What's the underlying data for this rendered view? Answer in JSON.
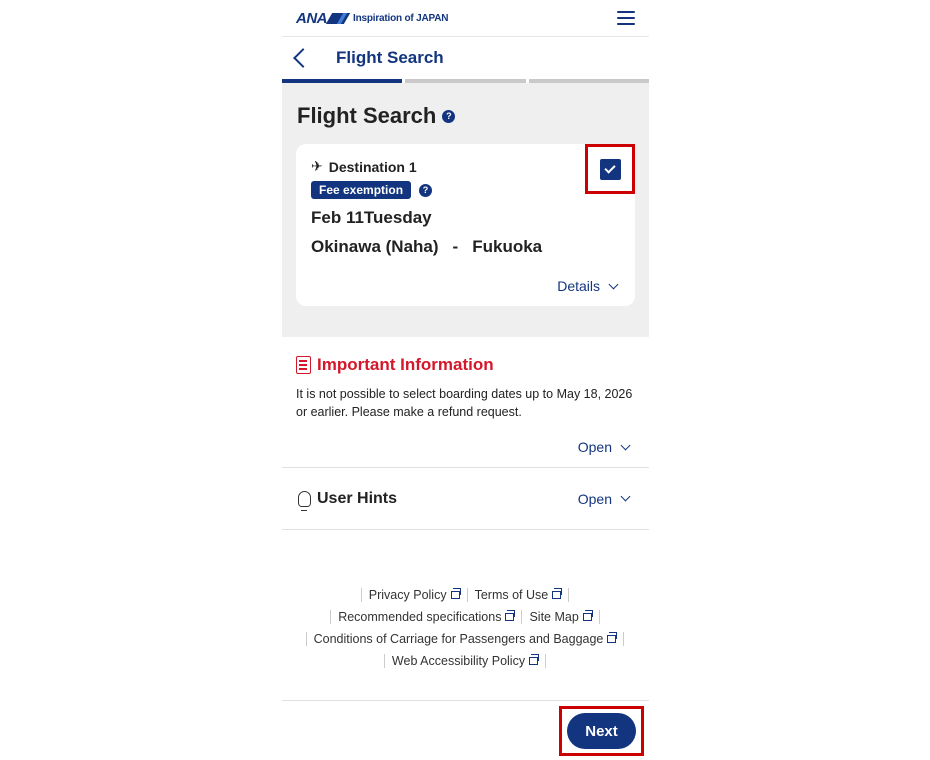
{
  "brand": {
    "logo": "ANA",
    "tagline": "Inspiration of JAPAN"
  },
  "header": {
    "title": "Flight Search"
  },
  "search": {
    "title": "Flight Search",
    "help": "?",
    "card": {
      "destination_label": "Destination 1",
      "badge": "Fee exemption",
      "badge_help": "?",
      "date": "Feb 11Tuesday",
      "origin": "Okinawa (Naha)",
      "separator": "-",
      "destination": "Fukuoka",
      "details_label": "Details",
      "checked": true
    }
  },
  "info": {
    "title": "Important Information",
    "text": "It is not possible to select boarding dates up to May 18, 2026 or earlier. Please make a refund request.",
    "open_label": "Open"
  },
  "hints": {
    "title": "User Hints",
    "open_label": "Open"
  },
  "footer": {
    "links": [
      "Privacy Policy",
      "Terms of Use",
      "Recommended specifications",
      "Site Map",
      "Conditions of Carriage for Passengers and Baggage",
      "Web Accessibility Policy"
    ]
  },
  "actions": {
    "next_label": "Next"
  },
  "colors": {
    "brand": "#13357f",
    "alert": "#d4172a",
    "highlight": "#cc0000",
    "section_bg": "#efefef"
  }
}
